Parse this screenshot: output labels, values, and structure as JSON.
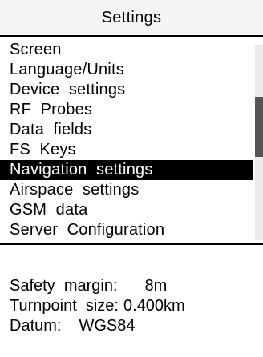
{
  "header": {
    "title": "Settings"
  },
  "menu": {
    "selected_index": 6,
    "items": [
      {
        "label": "Screen"
      },
      {
        "label": "Language/Units"
      },
      {
        "label": "Device  settings"
      },
      {
        "label": "RF  Probes"
      },
      {
        "label": "Data  fields"
      },
      {
        "label": "FS  Keys"
      },
      {
        "label": "Navigation  settings"
      },
      {
        "label": "Airspace  settings"
      },
      {
        "label": "GSM  data"
      },
      {
        "label": "Server  Configuration"
      }
    ]
  },
  "scrollbar": {
    "position_fraction": 0.27,
    "visible_fraction": 0.31
  },
  "info": {
    "safety_margin_label": "Safety  margin:",
    "safety_margin_value": "8m",
    "turnpoint_size_label": "Turnpoint  size:",
    "turnpoint_size_value": "0.400km",
    "datum_label": "Datum:",
    "datum_value": "WGS84"
  },
  "colors": {
    "selection_background": "#000000",
    "selection_text": "#ffffff",
    "scroll_track": "#ebebeb",
    "scroll_thumb": "#555555"
  }
}
